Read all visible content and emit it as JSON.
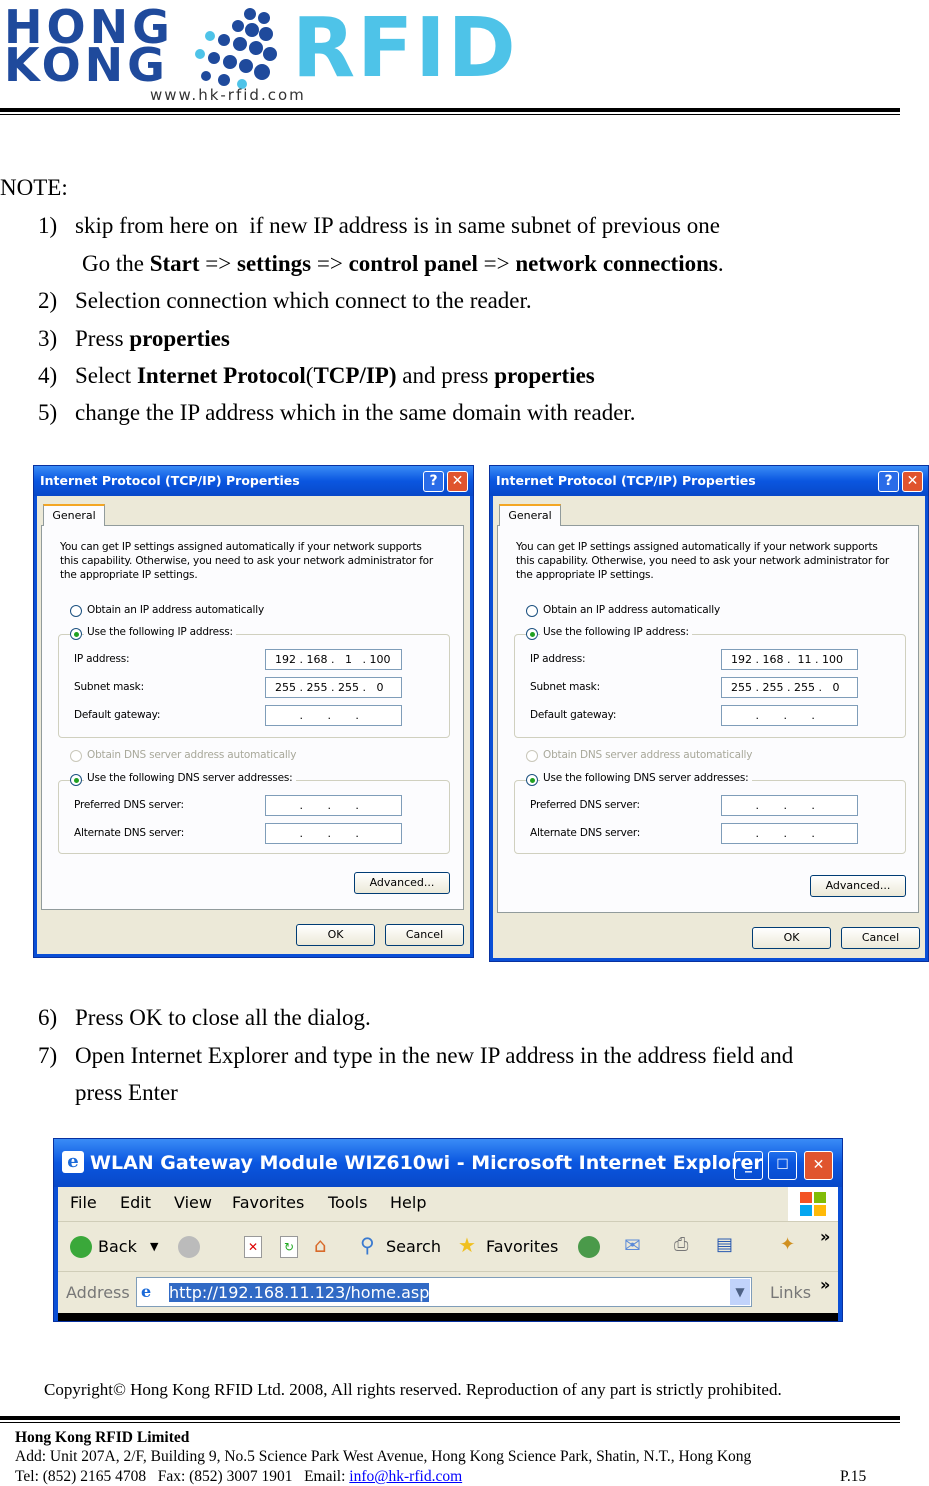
{
  "header": {
    "logo_line1": "HONG",
    "logo_line2": "KONG",
    "logo_brand": "RFID",
    "logo_url": "www.hk-rfid.com"
  },
  "note": {
    "heading": "NOTE:",
    "steps": [
      {
        "num": "1)",
        "parts": [
          {
            "t": "skip from here on  if new IP address is in same subnet of previous one"
          }
        ]
      },
      {
        "num": "",
        "parts": [
          {
            "t": "Go the "
          },
          {
            "t": "Start",
            "b": 1
          },
          {
            "t": " => "
          },
          {
            "t": "settings",
            "b": 1
          },
          {
            "t": " => "
          },
          {
            "t": "control panel",
            "b": 1
          },
          {
            "t": " => "
          },
          {
            "t": "network connections",
            "b": 1
          },
          {
            "t": "."
          }
        ]
      },
      {
        "num": "2)",
        "parts": [
          {
            "t": "Selection connection which connect to the reader."
          }
        ]
      },
      {
        "num": "3)",
        "parts": [
          {
            "t": "Press "
          },
          {
            "t": "properties",
            "b": 1
          }
        ]
      },
      {
        "num": "4)",
        "parts": [
          {
            "t": "Select "
          },
          {
            "t": "Internet Protocol",
            "b": 1
          },
          {
            "t": "("
          },
          {
            "t": "TCP/IP)",
            "b": 1
          },
          {
            "t": " and press "
          },
          {
            "t": "properties",
            "b": 1
          }
        ]
      },
      {
        "num": "5)",
        "parts": [
          {
            "t": "change the IP address which in the same domain with reader."
          }
        ]
      }
    ]
  },
  "dialogs": [
    {
      "title": "Internet Protocol (TCP/IP) Properties",
      "tab": "General",
      "intro1": "You can get IP settings assigned automatically if your network supports",
      "intro2": "this capability. Otherwise, you need to ask your network administrator for",
      "intro3": "the appropriate IP settings.",
      "obtain_ip": "Obtain an IP address automatically",
      "use_ip": "Use the following IP address:",
      "ip_label": "IP address:",
      "ip_value": "192 . 168 .   1   . 100",
      "mask_label": "Subnet mask:",
      "mask_value": "255 . 255 . 255 .   0",
      "gw_label": "Default gateway:",
      "empty_value": "       .       .       .",
      "obtain_dns": "Obtain DNS server address automatically",
      "use_dns": "Use the following DNS server addresses:",
      "pref_dns": "Preferred DNS server:",
      "alt_dns": "Alternate DNS server:",
      "advanced": "Advanced...",
      "ok": "OK",
      "cancel": "Cancel",
      "help": "?",
      "close": "✕"
    },
    {
      "title": "Internet Protocol (TCP/IP) Properties",
      "tab": "General",
      "intro1": "You can get IP settings assigned automatically if your network supports",
      "intro2": "this capability. Otherwise, you need to ask your network administrator for",
      "intro3": "the appropriate IP settings.",
      "obtain_ip": "Obtain an IP address automatically",
      "use_ip": "Use the following IP address:",
      "ip_label": "IP address:",
      "ip_value": "192 . 168 .  11 . 100",
      "mask_label": "Subnet mask:",
      "mask_value": "255 . 255 . 255 .   0",
      "gw_label": "Default gateway:",
      "empty_value": "       .       .       .",
      "obtain_dns": "Obtain DNS server address automatically",
      "use_dns": "Use the following DNS server addresses:",
      "pref_dns": "Preferred DNS server:",
      "alt_dns": "Alternate DNS server:",
      "advanced": "Advanced...",
      "ok": "OK",
      "cancel": "Cancel",
      "help": "?",
      "close": "✕"
    }
  ],
  "steps2": [
    {
      "num": "6)",
      "text": "Press OK to close all the dialog."
    },
    {
      "num": "7)",
      "text": "Open Internet Explorer and type in the new IP address in the address field and"
    },
    {
      "num": "",
      "text": "press Enter"
    }
  ],
  "ie": {
    "title": "WLAN Gateway Module WIZ610wi - Microsoft Internet Explorer",
    "menu": [
      "File",
      "Edit",
      "View",
      "Favorites",
      "Tools",
      "Help"
    ],
    "back": "Back",
    "search": "Search",
    "favorites": "Favorites",
    "address_label": "Address",
    "url": "http://192.168.11.123/home.asp",
    "links": "Links",
    "chevron": "»"
  },
  "copyright": "Copyright© Hong Kong RFID Ltd. 2008, All rights reserved. Reproduction of any part is strictly prohibited.",
  "footer": {
    "company": "Hong Kong RFID Limited",
    "address": "Add: Unit 207A, 2/F, Building 9, No.5 Science Park West Avenue, Hong Kong Science Park, Shatin, N.T., Hong Kong",
    "tel": "Tel: (852) 2165 4708   Fax: (852) 3007 1901   Email: ",
    "email": "info@hk-rfid.com",
    "page": "P.15"
  }
}
